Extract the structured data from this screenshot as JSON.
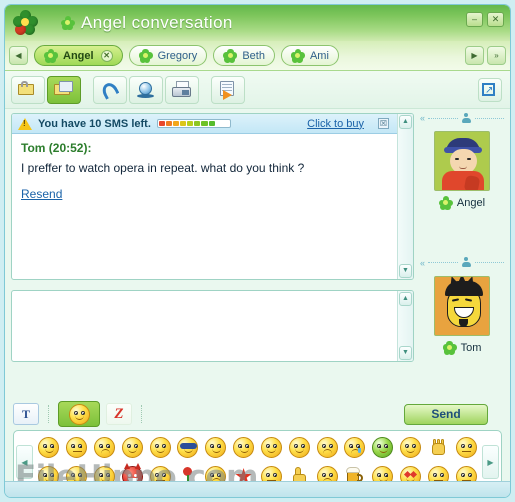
{
  "window": {
    "title": "Angel conversation",
    "logo_icon": "icq-flower-logo",
    "title_icon": "flower-icon",
    "minimize_label": "–",
    "close_label": "✕"
  },
  "tabbar": {
    "prev_label": "◀",
    "next_label": "▶",
    "overflow_label": "»",
    "tabs": [
      {
        "label": "Angel",
        "active": true,
        "close_label": "✕"
      },
      {
        "label": "Gregory",
        "active": false,
        "close_label": ""
      },
      {
        "label": "Beth",
        "active": false,
        "close_label": ""
      },
      {
        "label": "Ami",
        "active": false,
        "close_label": ""
      }
    ]
  },
  "toolbar": {
    "buttons": [
      {
        "name": "send-message-button",
        "icon": "note-icon",
        "active": false
      },
      {
        "name": "send-sms-button",
        "icon": "sms-note-icon",
        "active": true
      },
      {
        "name": "voice-call-button",
        "icon": "phone-icon",
        "active": false
      },
      {
        "name": "video-call-button",
        "icon": "webcam-icon",
        "active": false
      },
      {
        "name": "fax-button",
        "icon": "fax-icon",
        "active": false
      },
      {
        "name": "send-file-button",
        "icon": "send-file-icon",
        "active": false
      }
    ],
    "detach_icon": "detach-window-icon"
  },
  "sms_notice": {
    "warning_icon": "warning-triangle-icon",
    "text": "You have 10 SMS left.",
    "remaining": 10,
    "progress_segments": 10,
    "progress_filled": 8,
    "progress_colors": [
      "#e8482c",
      "#f07c22",
      "#f3a71c",
      "#dcc61a",
      "#b8cf1c",
      "#8ec722",
      "#6ec227",
      "#57bc2c"
    ],
    "buy_link": "Click to buy",
    "close_label": "☒"
  },
  "conversation": {
    "sender": "Tom (20:52):",
    "message": "I preffer to watch opera in repeat. what do you think ?",
    "resend_link": "Resend",
    "scroll_up_label": "▲",
    "scroll_down_label": "▼"
  },
  "input": {
    "value": "",
    "placeholder": "",
    "scroll_up_label": "▲",
    "scroll_down_label": "▼"
  },
  "contacts": [
    {
      "name": "Angel",
      "avatar": "angel-avatar",
      "collapse_label": "«",
      "person_icon": "person-icon",
      "flower_icon": "flower-icon"
    },
    {
      "name": "Tom",
      "avatar": "tom-avatar",
      "collapse_label": "«",
      "person_icon": "person-icon",
      "flower_icon": "flower-icon"
    }
  ],
  "bottombar": {
    "text_format_label": "T",
    "smiley_icon": "smiley-wink-icon",
    "zoom_label": "Z",
    "send_label": "Send"
  },
  "emoticon_panel": {
    "prev_label": "◀",
    "next_label": "▶",
    "row1": [
      "smile-icon",
      "neutral-icon",
      "frown-icon",
      "surprised-icon",
      "grin-icon",
      "cool-sunglasses-icon",
      "tongue-out-icon",
      "drink-icon",
      "wink-icon",
      "laugh-icon",
      "confused-icon",
      "sweat-icon",
      "sick-green-icon",
      "kiss-icon",
      "wave-hand-icon",
      "blank-icon"
    ],
    "row2": [
      "big-grin-icon",
      "hug-icon",
      "roll-eyes-icon",
      "devil-icon",
      "nerd-icon",
      "rose-icon",
      "dizzy-icon",
      "star-burst-icon",
      "thinking-icon",
      "thumbs-up-icon",
      "worried-icon",
      "beer-mug-icon",
      "happy-icon",
      "heart-eyes-icon",
      "blank-icon",
      "blank-icon"
    ]
  },
  "watermark": {
    "text": "FileHippo.com"
  },
  "colors": {
    "titlebar_green": "#7ec65c",
    "accent_green": "#58c23c",
    "link_blue": "#1a62a8",
    "sender_green": "#2c7d2c",
    "panel_bg": "#eaf8ef"
  }
}
